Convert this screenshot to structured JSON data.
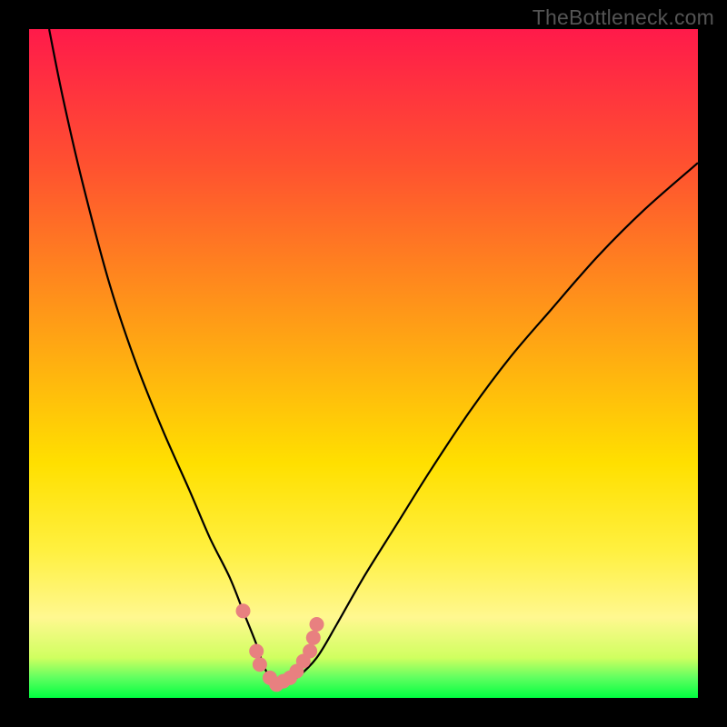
{
  "watermark": "TheBottleneck.com",
  "chart_data": {
    "type": "line",
    "title": "",
    "xlabel": "",
    "ylabel": "",
    "xlim": [
      0,
      100
    ],
    "ylim": [
      0,
      100
    ],
    "series": [
      {
        "name": "bottleneck-curve",
        "x": [
          3,
          5,
          8,
          12,
          16,
          20,
          24,
          27,
          30,
          32,
          34,
          35,
          36,
          37,
          38,
          40,
          43,
          46,
          50,
          55,
          60,
          66,
          72,
          78,
          85,
          92,
          100
        ],
        "y": [
          100,
          90,
          77,
          62,
          50,
          40,
          31,
          24,
          18,
          13,
          8,
          5,
          3,
          2,
          2,
          3,
          6,
          11,
          18,
          26,
          34,
          43,
          51,
          58,
          66,
          73,
          80
        ]
      }
    ],
    "markers": {
      "name": "highlight-dots",
      "color": "#e88080",
      "points": [
        {
          "x": 32,
          "y": 13
        },
        {
          "x": 34,
          "y": 7
        },
        {
          "x": 34.5,
          "y": 5
        },
        {
          "x": 36,
          "y": 3
        },
        {
          "x": 37,
          "y": 2
        },
        {
          "x": 38,
          "y": 2.5
        },
        {
          "x": 39,
          "y": 3
        },
        {
          "x": 40,
          "y": 4
        },
        {
          "x": 41,
          "y": 5.5
        },
        {
          "x": 42,
          "y": 7
        },
        {
          "x": 42.5,
          "y": 9
        },
        {
          "x": 43,
          "y": 11
        }
      ]
    },
    "gradient_stops": [
      {
        "pos": 0,
        "color": "#ff1a4a"
      },
      {
        "pos": 8,
        "color": "#ff3040"
      },
      {
        "pos": 20,
        "color": "#ff5030"
      },
      {
        "pos": 35,
        "color": "#ff8020"
      },
      {
        "pos": 50,
        "color": "#ffb010"
      },
      {
        "pos": 65,
        "color": "#ffe000"
      },
      {
        "pos": 78,
        "color": "#fff040"
      },
      {
        "pos": 88,
        "color": "#fff890"
      },
      {
        "pos": 94,
        "color": "#d0ff60"
      },
      {
        "pos": 97,
        "color": "#60ff60"
      },
      {
        "pos": 100,
        "color": "#00ff40"
      }
    ]
  }
}
